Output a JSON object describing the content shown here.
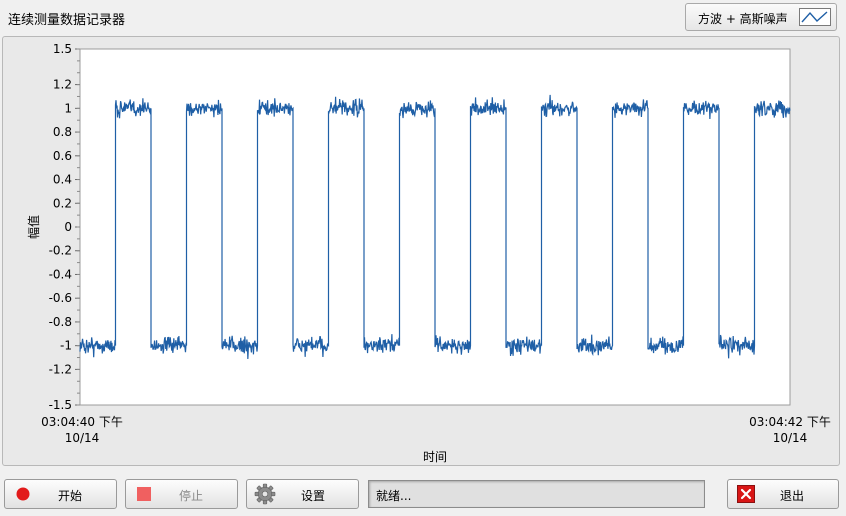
{
  "window": {
    "title": "连续测量数据记录器"
  },
  "legend": {
    "label": "方波 + 高斯噪声",
    "icon": "line-plot-icon"
  },
  "chart_data": {
    "type": "line",
    "title": "",
    "xlabel": "时间",
    "ylabel": "幅值",
    "ylim": [
      -1.5,
      1.5
    ],
    "yticks": [
      1.5,
      1.2,
      1,
      0.8,
      0.6,
      0.4,
      0.2,
      0,
      -0.2,
      -0.4,
      -0.6,
      -0.8,
      -1,
      -1.2,
      -1.5
    ],
    "x_start_label": {
      "time": "03:04:40 下午",
      "date": "10/14"
    },
    "x_end_label": {
      "time": "03:04:42 下午",
      "date": "10/14"
    },
    "xlim_seconds": [
      0,
      2
    ],
    "grid": false,
    "series": [
      {
        "color": "#1f5fa6",
        "waveform": "square",
        "amplitude": 1,
        "period_seconds": 0.2,
        "noise_sigma": 0.04,
        "initial_level": -1,
        "rising_edges_seconds": [
          0.1,
          0.3,
          0.5,
          0.7,
          0.9,
          1.1,
          1.3,
          1.5,
          1.7,
          1.9
        ],
        "falling_edges_seconds": [
          0.2,
          0.4,
          0.6,
          0.8,
          1.0,
          1.2,
          1.4,
          1.6,
          1.8
        ]
      }
    ]
  },
  "buttons": {
    "start": {
      "label": "开始",
      "color": "#e21b1b"
    },
    "stop": {
      "label": "停止",
      "color": "#f06060"
    },
    "settings": {
      "label": "设置"
    },
    "exit": {
      "label": "退出",
      "color": "#d91616"
    }
  },
  "status": {
    "text": "就绪..."
  }
}
